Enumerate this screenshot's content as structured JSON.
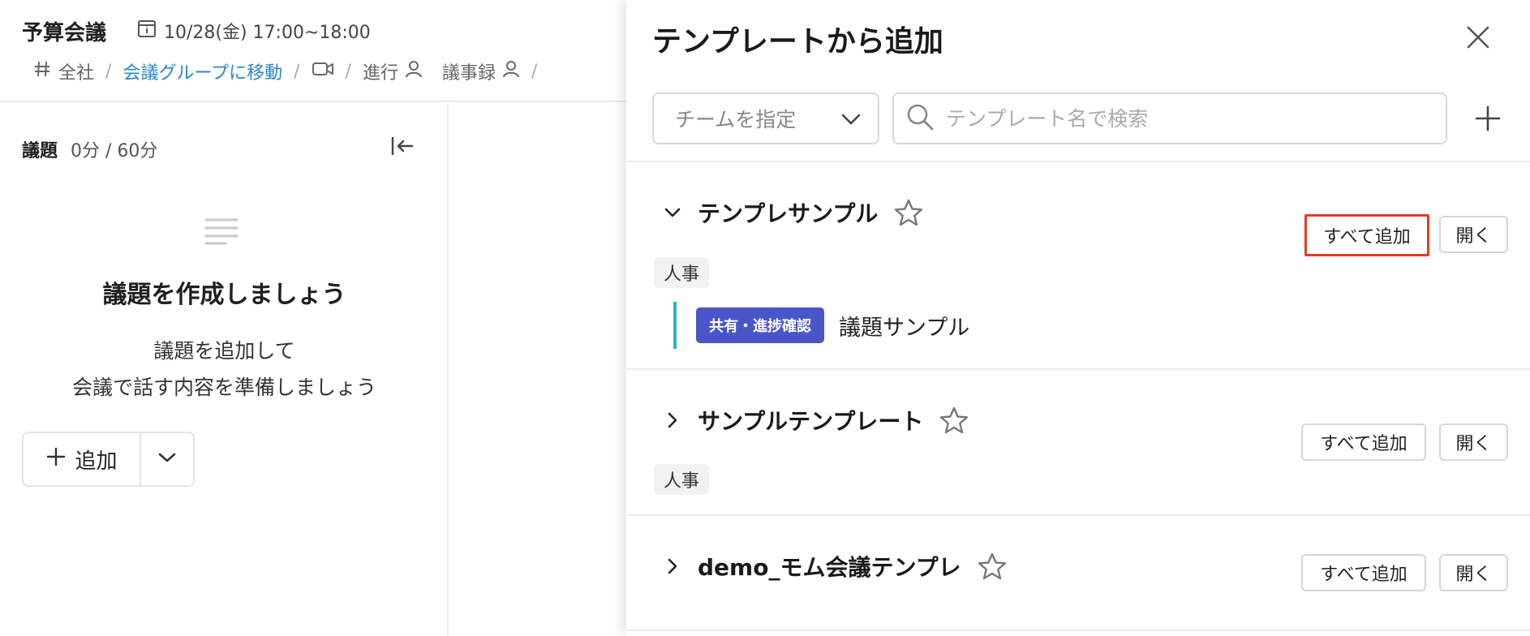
{
  "meeting": {
    "title": "予算会議",
    "datetime": "10/28(金) 17:00~18:00",
    "breadcrumb": {
      "channel": "全社",
      "group_link": "会議グループに移動",
      "facilitator": "進行",
      "minutes": "議事録"
    }
  },
  "agenda_panel": {
    "label": "議題",
    "time": "0分 / 60分",
    "empty_title": "議題を作成しましょう",
    "empty_desc_line1": "議題を追加して",
    "empty_desc_line2": "会議で話す内容を準備しましょう",
    "add_label": "追加"
  },
  "drawer": {
    "title": "テンプレートから追加",
    "team_select": "チームを指定",
    "search_placeholder": "テンプレート名で検索",
    "templates": [
      {
        "name": "テンプレサンプル",
        "expanded": true,
        "tag": "人事",
        "add_all_label": "すべて追加",
        "open_label": "開く",
        "items": [
          {
            "category": "共有・進捗確認",
            "title": "議題サンプル"
          }
        ]
      },
      {
        "name": "サンプルテンプレート",
        "expanded": false,
        "tag": "人事",
        "add_all_label": "すべて追加",
        "open_label": "開く"
      },
      {
        "name": "demo_モム会議テンプレ",
        "expanded": false,
        "add_all_label": "すべて追加",
        "open_label": "開く"
      }
    ]
  },
  "colors": {
    "link": "#2f86c9",
    "category_badge": "#4a56c8",
    "agenda_accent": "#22b8c8",
    "highlight": "#e53b22"
  },
  "icons": [
    "calendar-icon",
    "hash-icon",
    "video-icon",
    "person-icon",
    "collapse-left-icon",
    "lines-icon",
    "plus-icon",
    "chevron-down-icon",
    "close-icon",
    "search-icon",
    "chevron-right-icon",
    "star-icon"
  ]
}
